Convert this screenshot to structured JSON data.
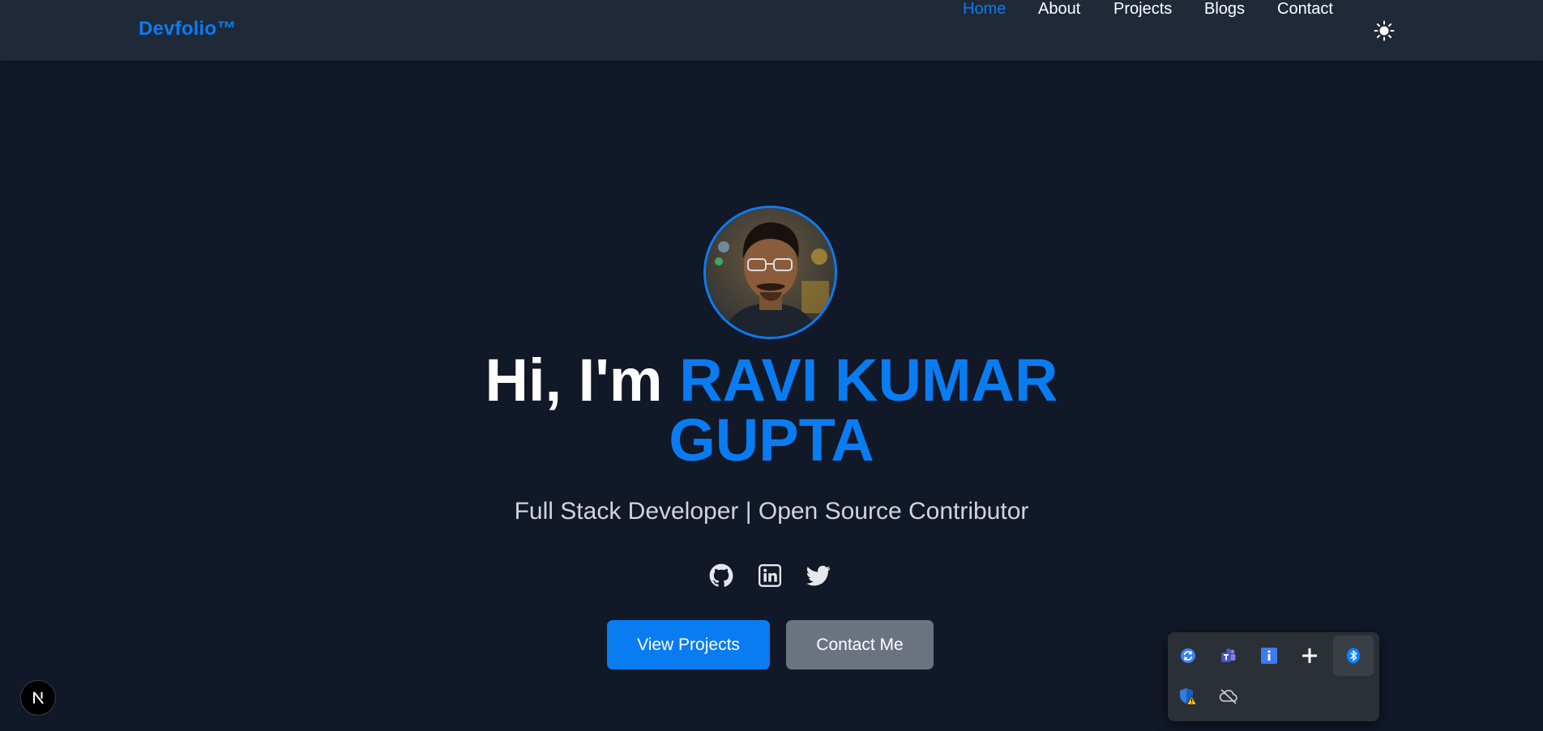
{
  "navbar": {
    "brand": "Devfolio™",
    "links": [
      {
        "label": "Home",
        "active": true
      },
      {
        "label": "About",
        "active": false
      },
      {
        "label": "Projects",
        "active": false
      },
      {
        "label": "Blogs",
        "active": false
      },
      {
        "label": "Contact",
        "active": false
      }
    ],
    "theme_toggle_icon": "sun-icon"
  },
  "hero": {
    "avatar_icon": "profile-photo",
    "greeting": "Hi, I'm",
    "name_line1": "RAVI KUMAR",
    "name_line2": "GUPTA",
    "subtitle": "Full Stack Developer | Open Source Contributor",
    "social_icons": [
      "github-icon",
      "linkedin-icon",
      "twitter-icon"
    ],
    "primary_button": "View Projects",
    "secondary_button": "Contact Me"
  },
  "dev_badge": {
    "letter": "N",
    "icon": "nextjs-icon"
  },
  "system_tray": {
    "icons": [
      "sync-icon",
      "teams-icon",
      "info-icon",
      "plus-icon",
      "bluetooth-icon",
      "security-warning-icon",
      "cloud-offline-icon"
    ]
  },
  "colors": {
    "accent": "#0a7cf2",
    "background": "#111827",
    "navbar": "#1f2937",
    "secondary_button": "#6b7280",
    "subtitle": "#d1d5db"
  }
}
